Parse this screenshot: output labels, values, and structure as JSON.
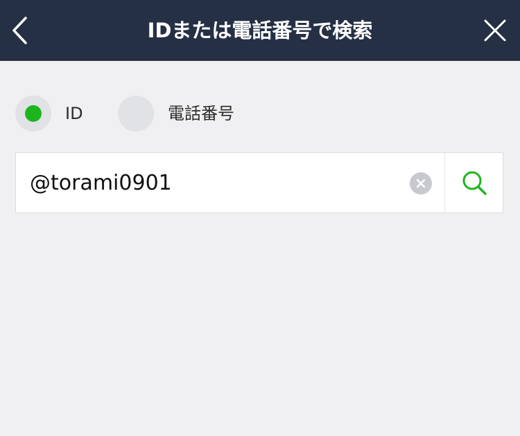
{
  "header": {
    "title": "IDまたは電話番号で検索",
    "back_icon": "chevron-left-icon",
    "close_icon": "close-icon",
    "background_color": "#263045"
  },
  "search_type": {
    "options": [
      {
        "label": "ID",
        "selected": true
      },
      {
        "label": "電話番号",
        "selected": false
      }
    ],
    "selected_color": "#1db51d"
  },
  "search": {
    "value": "@torami0901",
    "clear_icon": "clear-icon",
    "search_icon": "search-icon",
    "accent_color": "#1db51d"
  }
}
